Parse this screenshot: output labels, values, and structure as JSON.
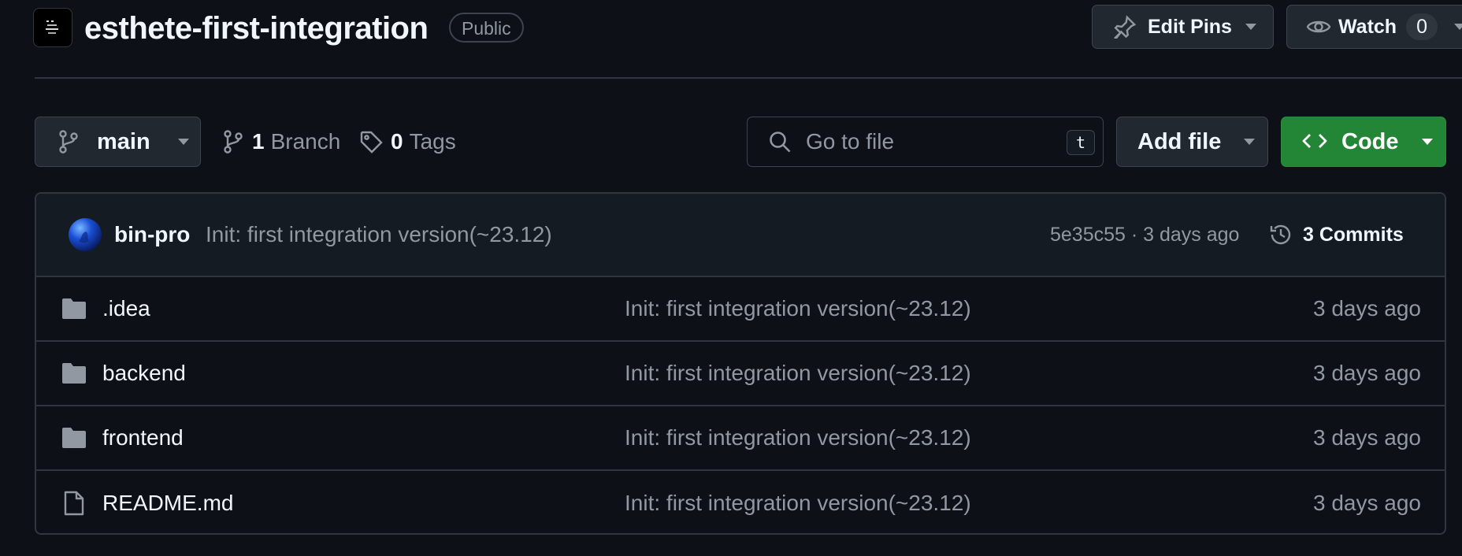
{
  "repo": {
    "name": "esthete-first-integration",
    "visibility": "Public"
  },
  "header_actions": {
    "edit_pins_label": "Edit Pins",
    "watch_label": "Watch",
    "watch_count": "0"
  },
  "toolbar": {
    "branch": "main",
    "branch_count": "1",
    "branch_label": "Branch",
    "tag_count": "0",
    "tag_label": "Tags",
    "search_placeholder": "Go to file",
    "search_shortcut": "t",
    "add_file_label": "Add file",
    "code_label": "Code"
  },
  "latest_commit": {
    "author": "bin-pro",
    "message": "Init: first integration version(~23.12)",
    "hash_time": "5e35c55 · 3 days ago",
    "commits_label": "3 Commits"
  },
  "files": [
    {
      "name": ".idea",
      "type": "folder",
      "message": "Init: first integration version(~23.12)",
      "time": "3 days ago"
    },
    {
      "name": "backend",
      "type": "folder",
      "message": "Init: first integration version(~23.12)",
      "time": "3 days ago"
    },
    {
      "name": "frontend",
      "type": "folder",
      "message": "Init: first integration version(~23.12)",
      "time": "3 days ago"
    },
    {
      "name": "README.md",
      "type": "file",
      "message": "Init: first integration version(~23.12)",
      "time": "3 days ago"
    }
  ],
  "colors": {
    "background": "#0d1117",
    "code_button": "#238636",
    "border": "#30363d",
    "muted_text": "#9198a1"
  }
}
